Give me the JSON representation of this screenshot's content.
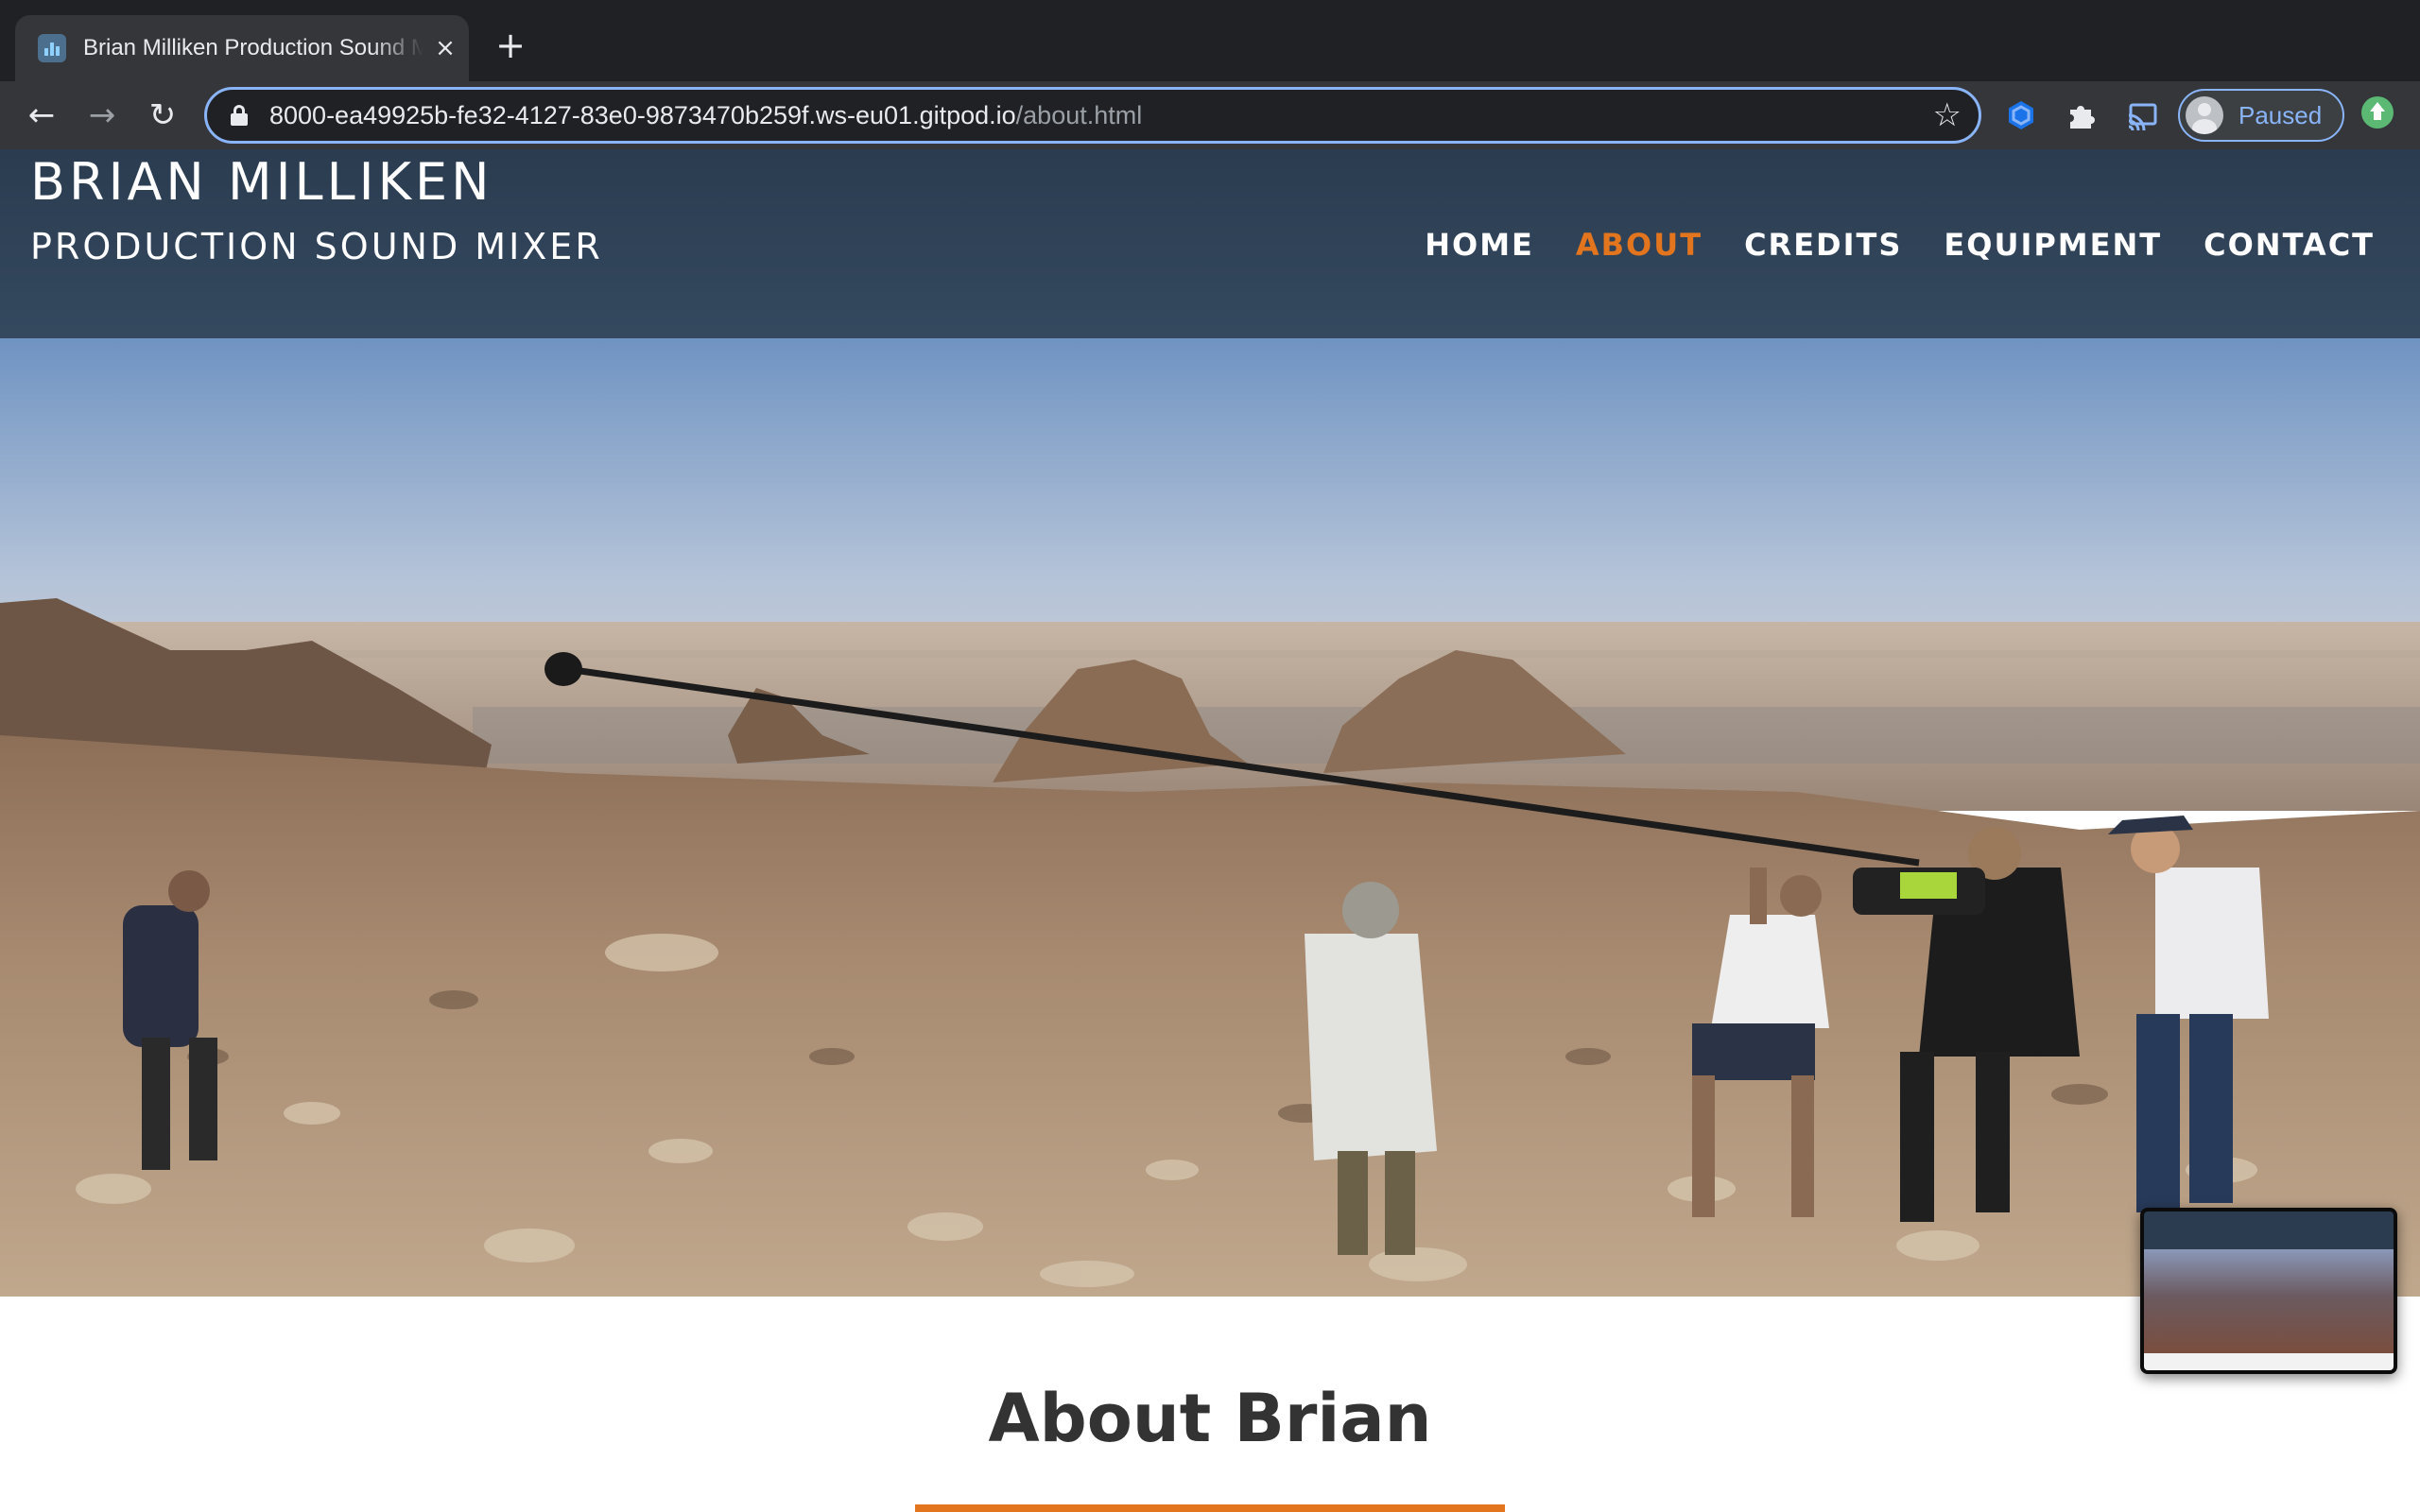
{
  "browser": {
    "tab": {
      "title": "Brian Milliken Production Sound Mixer",
      "close_glyph": "×",
      "favicon": "bar-chart-icon"
    },
    "new_tab_glyph": "+",
    "nav": {
      "back_glyph": "←",
      "forward_glyph": "→",
      "reload_glyph": "↻"
    },
    "address": {
      "host": "8000-ea49925b-fe32-4127-83e0-9873470b259f.ws-eu01.gitpod.io",
      "path": "/about.html"
    },
    "bookmark_glyph": "☆",
    "extensions": [
      "hexagon-extension-icon",
      "puzzle-icon",
      "cast-icon"
    ],
    "profile": {
      "status": "Paused"
    },
    "accent_color": "#8ab4f8",
    "update_color": "#5bb974"
  },
  "site": {
    "brand": {
      "name": "BRIAN MILLIKEN",
      "subtitle": "PRODUCTION SOUND MIXER"
    },
    "nav": [
      {
        "label": "HOME",
        "active": false
      },
      {
        "label": "ABOUT",
        "active": true
      },
      {
        "label": "CREDITS",
        "active": false
      },
      {
        "label": "EQUIPMENT",
        "active": false
      },
      {
        "label": "CONTACT",
        "active": false
      }
    ],
    "hero": {
      "description": "film crew on rocky desert mountain"
    },
    "about": {
      "title": "About Brian"
    },
    "colors": {
      "header": "#2b3c50",
      "accent": "#e2751d",
      "text": "#333333"
    }
  }
}
